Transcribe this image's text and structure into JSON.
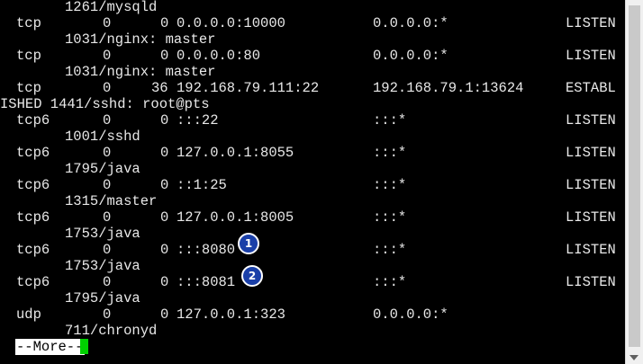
{
  "header": {
    "pid_program": "1261/mysqld"
  },
  "rows": [
    {
      "proto": "tcp",
      "recv": "0",
      "send": "0",
      "local": "0.0.0.0:10000",
      "foreign": "0.0.0.0:*",
      "state": "LISTEN",
      "pid_program": "1031/nginx: master"
    },
    {
      "proto": "tcp",
      "recv": "0",
      "send": "0",
      "local": "0.0.0.0:80",
      "foreign": "0.0.0.0:*",
      "state": "LISTEN",
      "pid_program": "1031/nginx: master"
    },
    {
      "proto": "tcp",
      "recv": "0",
      "send": "36",
      "local": "192.168.79.111:22",
      "foreign": "192.168.79.1:13624",
      "state": "ESTABL",
      "pid_program": "ISHED 1441/sshd: root@pts"
    },
    {
      "proto": "tcp6",
      "recv": "0",
      "send": "0",
      "local": ":::22",
      "foreign": ":::*",
      "state": "LISTEN",
      "pid_program": "1001/sshd"
    },
    {
      "proto": "tcp6",
      "recv": "0",
      "send": "0",
      "local": "127.0.0.1:8055",
      "foreign": ":::*",
      "state": "LISTEN",
      "pid_program": "1795/java"
    },
    {
      "proto": "tcp6",
      "recv": "0",
      "send": "0",
      "local": "::1:25",
      "foreign": ":::*",
      "state": "LISTEN",
      "pid_program": "1315/master"
    },
    {
      "proto": "tcp6",
      "recv": "0",
      "send": "0",
      "local": "127.0.0.1:8005",
      "foreign": ":::*",
      "state": "LISTEN",
      "pid_program": "1753/java"
    },
    {
      "proto": "tcp6",
      "recv": "0",
      "send": "0",
      "local": ":::8080",
      "foreign": ":::*",
      "state": "LISTEN",
      "pid_program": "1753/java"
    },
    {
      "proto": "tcp6",
      "recv": "0",
      "send": "0",
      "local": ":::8081",
      "foreign": ":::*",
      "state": "LISTEN",
      "pid_program": "1795/java"
    },
    {
      "proto": "udp",
      "recv": "0",
      "send": "0",
      "local": "127.0.0.1:323",
      "foreign": "0.0.0.0:*",
      "state": "",
      "pid_program": "711/chronyd"
    }
  ],
  "pager": {
    "prompt": "--More--"
  },
  "annotations": [
    "1",
    "2"
  ],
  "colors": {
    "background": "#000000",
    "text": "#e8e8e8",
    "cursor": "#00d000",
    "badge": "#1a3fa8"
  }
}
